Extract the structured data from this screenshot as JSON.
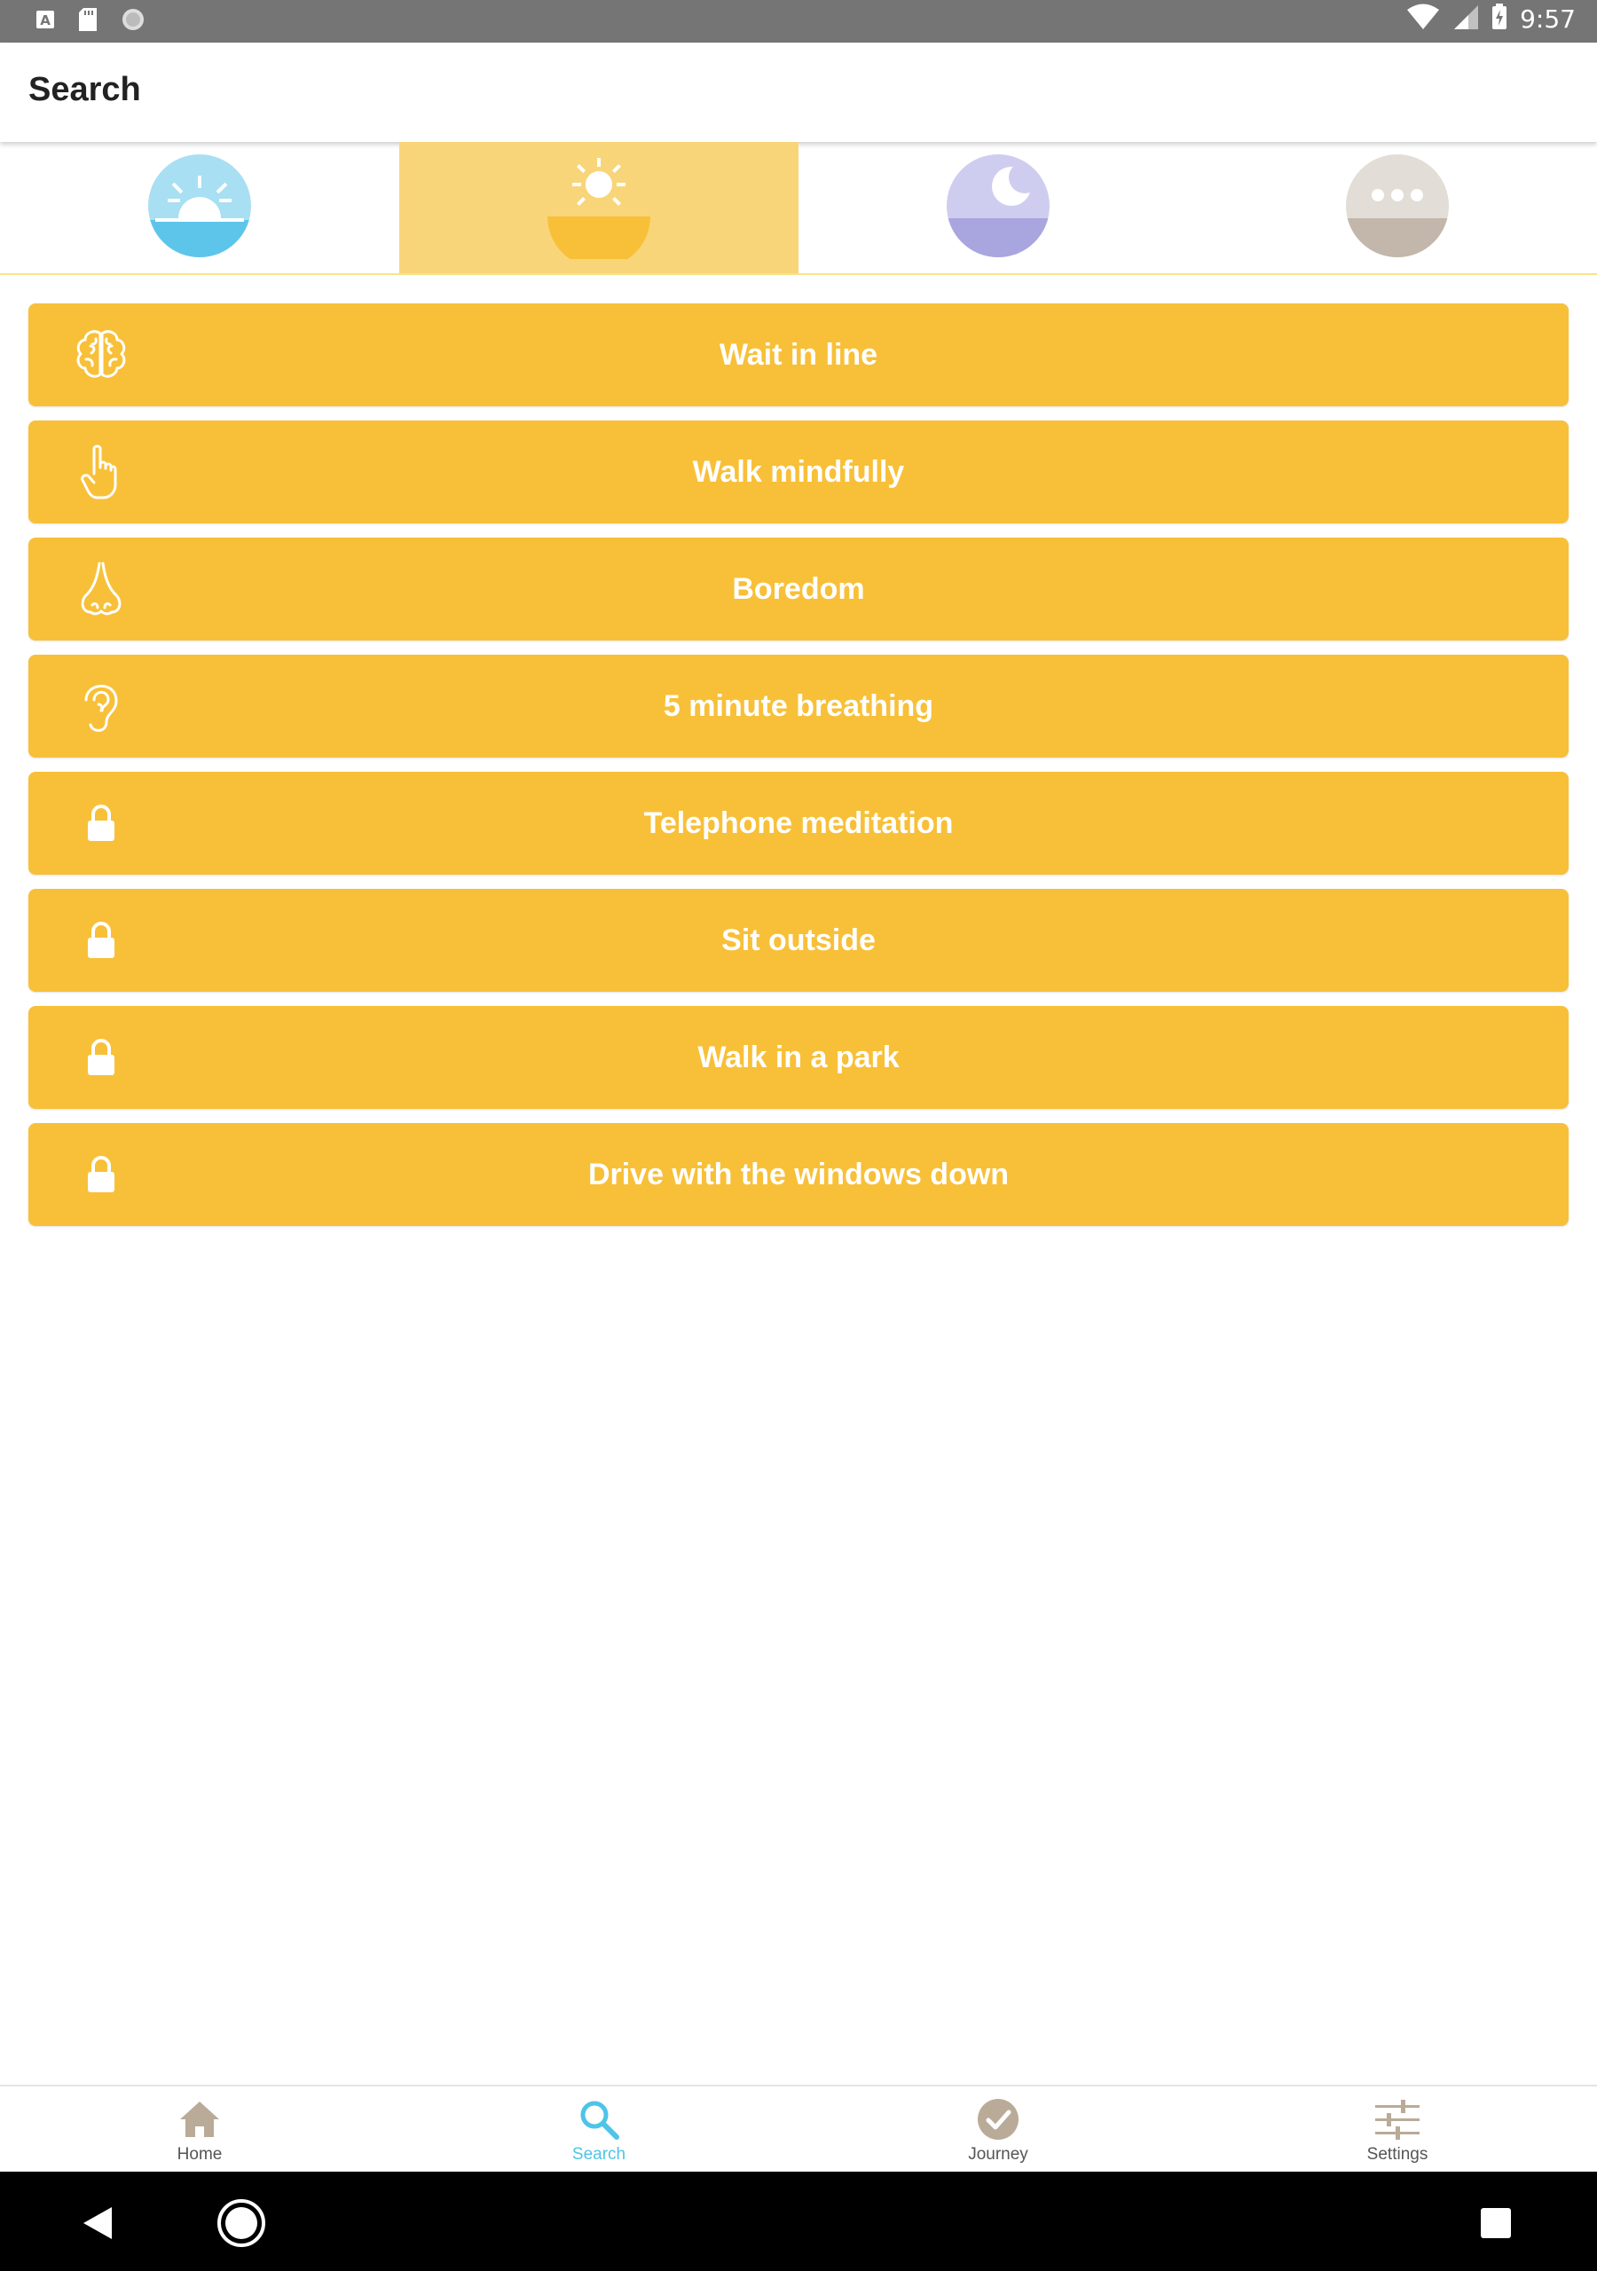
{
  "status_bar": {
    "time": "9:57",
    "left_icons": [
      "a-icon",
      "sd-card-icon",
      "circle-icon"
    ],
    "right_icons": [
      "wifi-icon",
      "signal-icon",
      "battery-charging-icon"
    ]
  },
  "appbar": {
    "title": "Search"
  },
  "tabs": [
    {
      "name": "sunrise",
      "icon": "sunrise-icon",
      "color": "#5ec5ea",
      "selected": false
    },
    {
      "name": "midday",
      "icon": "sun-icon",
      "color": "#f8c038",
      "selected": true
    },
    {
      "name": "night",
      "icon": "moon-icon",
      "color": "#a9a5df",
      "selected": false
    },
    {
      "name": "more",
      "icon": "more-icon",
      "color": "#d6d0c6",
      "selected": false
    }
  ],
  "activities": [
    {
      "label": "Wait in line",
      "icon": "brain-icon",
      "locked": false
    },
    {
      "label": "Walk mindfully",
      "icon": "hand-pointer-icon",
      "locked": false
    },
    {
      "label": "Boredom",
      "icon": "nose-icon",
      "locked": false
    },
    {
      "label": "5 minute breathing",
      "icon": "ear-icon",
      "locked": false
    },
    {
      "label": "Telephone meditation",
      "icon": "lock-icon",
      "locked": true
    },
    {
      "label": "Sit outside",
      "icon": "lock-icon",
      "locked": true
    },
    {
      "label": "Walk in a park",
      "icon": "lock-icon",
      "locked": true
    },
    {
      "label": "Drive with the windows down",
      "icon": "lock-icon",
      "locked": true
    }
  ],
  "bottom_nav": [
    {
      "label": "Home",
      "icon": "home-icon",
      "active": false
    },
    {
      "label": "Search",
      "icon": "search-icon",
      "active": true
    },
    {
      "label": "Journey",
      "icon": "check-circle-icon",
      "active": false
    },
    {
      "label": "Settings",
      "icon": "sliders-icon",
      "active": false
    }
  ],
  "system_nav": [
    "back-icon",
    "home-circle-icon",
    "recents-icon"
  ],
  "colors": {
    "accent": "#f8c038",
    "accent_light": "#f9d57a",
    "active_nav": "#4ec4e8",
    "nav_icon": "#b9ab98"
  }
}
